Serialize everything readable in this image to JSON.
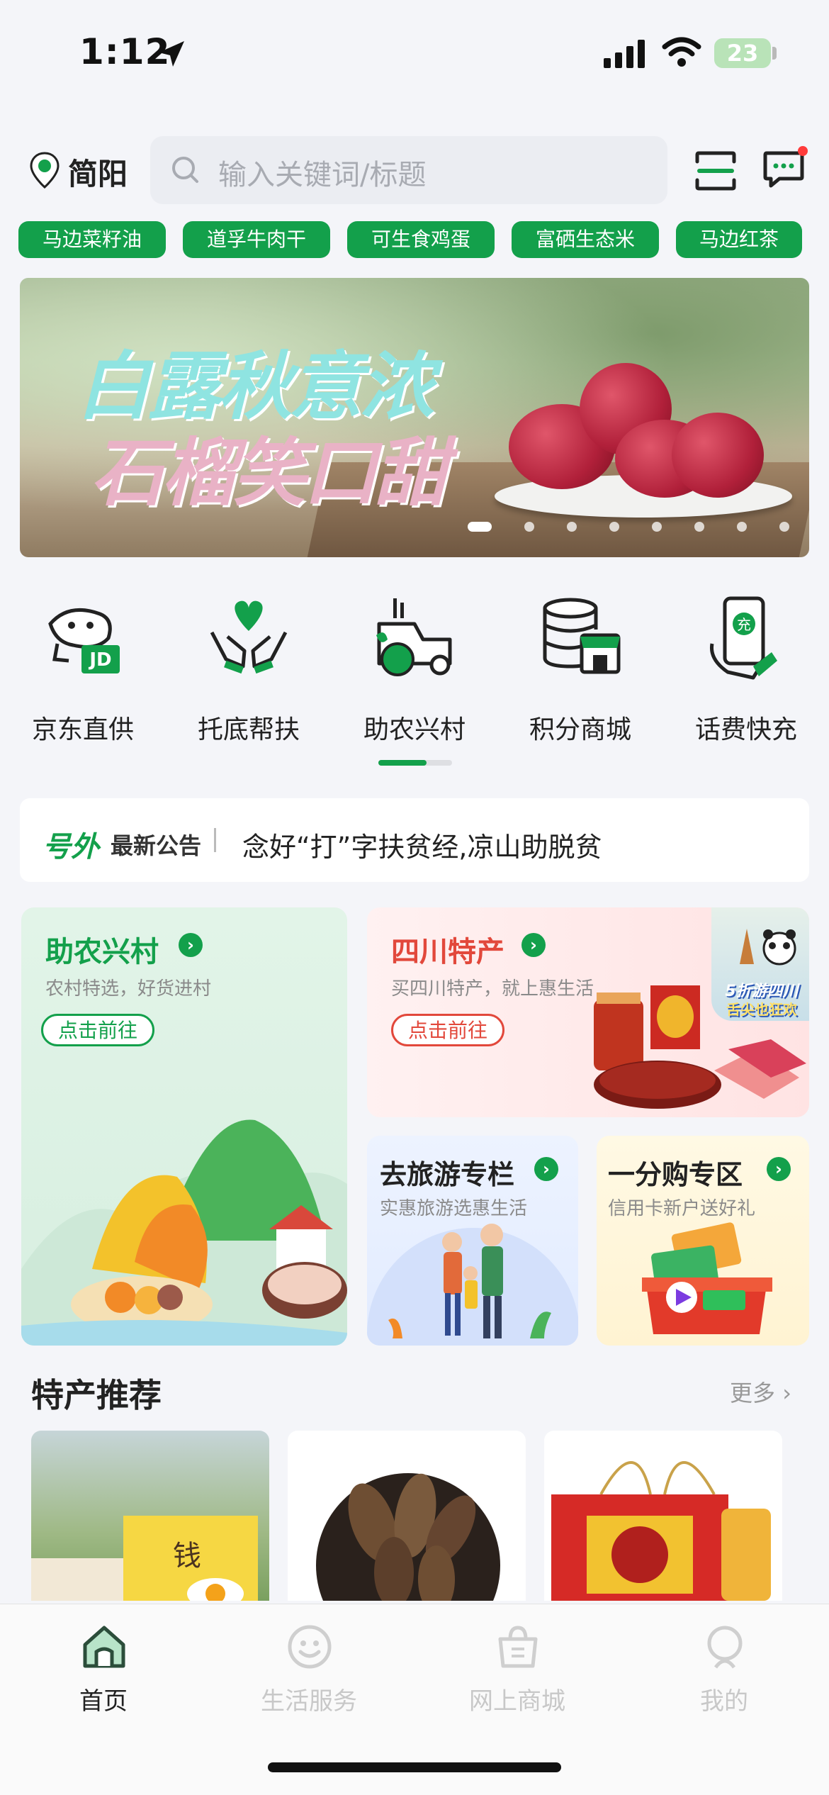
{
  "status_bar": {
    "time": "1:12",
    "battery": "23"
  },
  "header": {
    "city": "简阳",
    "search_placeholder": "输入关键词/标题",
    "chips": [
      "马边菜籽油",
      "道孚牛肉干",
      "可生食鸡蛋",
      "富硒生态米",
      "马边红茶"
    ]
  },
  "banner": {
    "line1": "白露秋意浓",
    "line2": "石榴笑口甜",
    "slide_count": 8,
    "active_slide": 1
  },
  "quick_menu": {
    "items": [
      {
        "label": "京东直供",
        "icon": "jd-dog-icon"
      },
      {
        "label": "托底帮扶",
        "icon": "helping-hands-heart-icon"
      },
      {
        "label": "助农兴村",
        "icon": "tractor-icon"
      },
      {
        "label": "积分商城",
        "icon": "coins-shop-icon"
      },
      {
        "label": "话费快充",
        "icon": "phone-recharge-icon"
      }
    ],
    "page_progress": 0.65
  },
  "notice": {
    "logo": "号外",
    "label": "最新公告",
    "text": "念好“打”字扶贫经,凉山助脱贫"
  },
  "promos": {
    "village": {
      "title": "助农兴村",
      "subtitle": "农村特选，好货进村",
      "button": "点击前往"
    },
    "sichuan": {
      "title": "四川特产",
      "subtitle": "买四川特产，就上惠生活",
      "button": "点击前往",
      "badge_line1": "5折游四川",
      "badge_line2": "舌尖也狂欢"
    },
    "travel": {
      "title": "去旅游专栏",
      "subtitle": "实惠旅游选惠生活"
    },
    "penny": {
      "title": "一分购专区",
      "subtitle": "信用卡新户送好礼"
    }
  },
  "specialty": {
    "title": "特产推荐",
    "more": "更多"
  },
  "tabbar": {
    "items": [
      {
        "label": "首页",
        "active": true
      },
      {
        "label": "生活服务",
        "active": false
      },
      {
        "label": "网上商城",
        "active": false
      },
      {
        "label": "我的",
        "active": false
      }
    ]
  },
  "colors": {
    "brand_green": "#13a04b",
    "sichuan_red": "#e2483b",
    "travel_blue": "#3a6fd8",
    "penny_orange": "#d98a14"
  }
}
